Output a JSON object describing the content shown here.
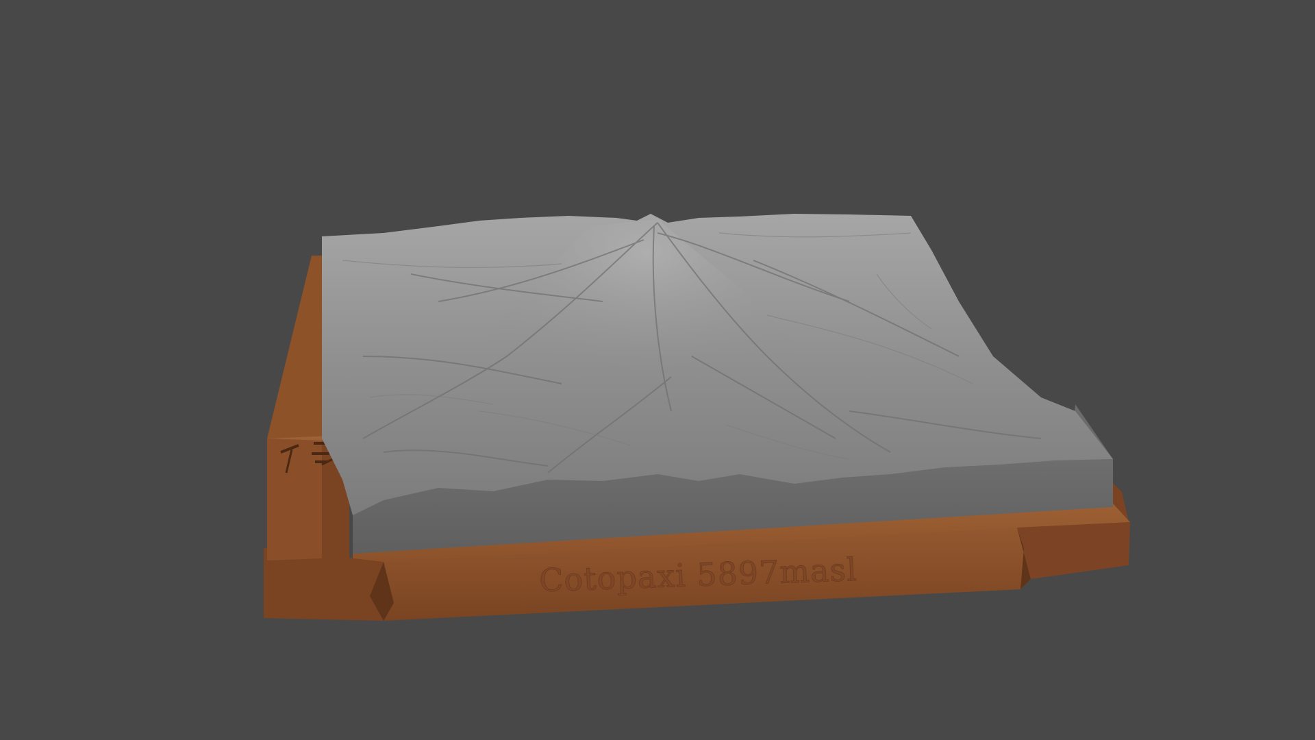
{
  "scene": {
    "background_color": "#484848",
    "terrain_color": "#8c8c8c",
    "base_color": "#8a4f28",
    "model_subject": "terrain relief model on a wooden-style base"
  },
  "base_plaque": {
    "text": "Cotopaxi 5897masl"
  },
  "side_tag": {
    "icons": [
      "hammer-icon",
      "bars-icon"
    ]
  }
}
